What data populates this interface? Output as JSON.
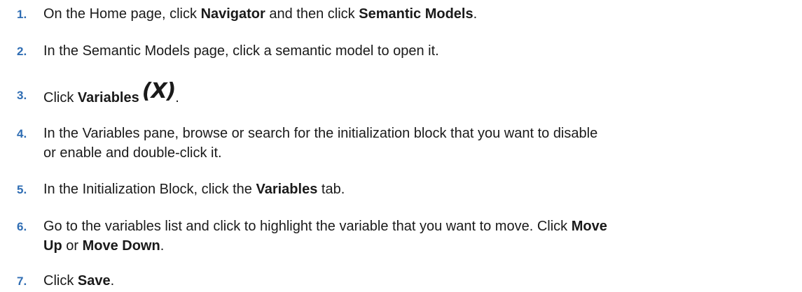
{
  "steps": [
    {
      "number": "1.",
      "parts": [
        "On the Home page, click ",
        "Navigator",
        " and then click ",
        "Semantic Models",
        "."
      ]
    },
    {
      "number": "2.",
      "text": "In the Semantic Models page, click a semantic model to open it."
    },
    {
      "number": "3.",
      "parts": [
        "Click ",
        "Variables",
        "(X)",
        "."
      ]
    },
    {
      "number": "4.",
      "lines": [
        "In the Variables pane, browse or search for the initialization block that you want to disable",
        "or enable and double-click it."
      ]
    },
    {
      "number": "5.",
      "parts": [
        "In the Initialization Block, click the ",
        "Variables",
        " tab."
      ]
    },
    {
      "number": "6.",
      "line1_parts": [
        "Go to the variables list and click to highlight the variable that you want to move. Click ",
        "Move"
      ],
      "line2_parts": [
        "Up",
        " or ",
        "Move Down",
        "."
      ]
    },
    {
      "number": "7.",
      "parts": [
        "Click ",
        "Save",
        "."
      ]
    }
  ]
}
